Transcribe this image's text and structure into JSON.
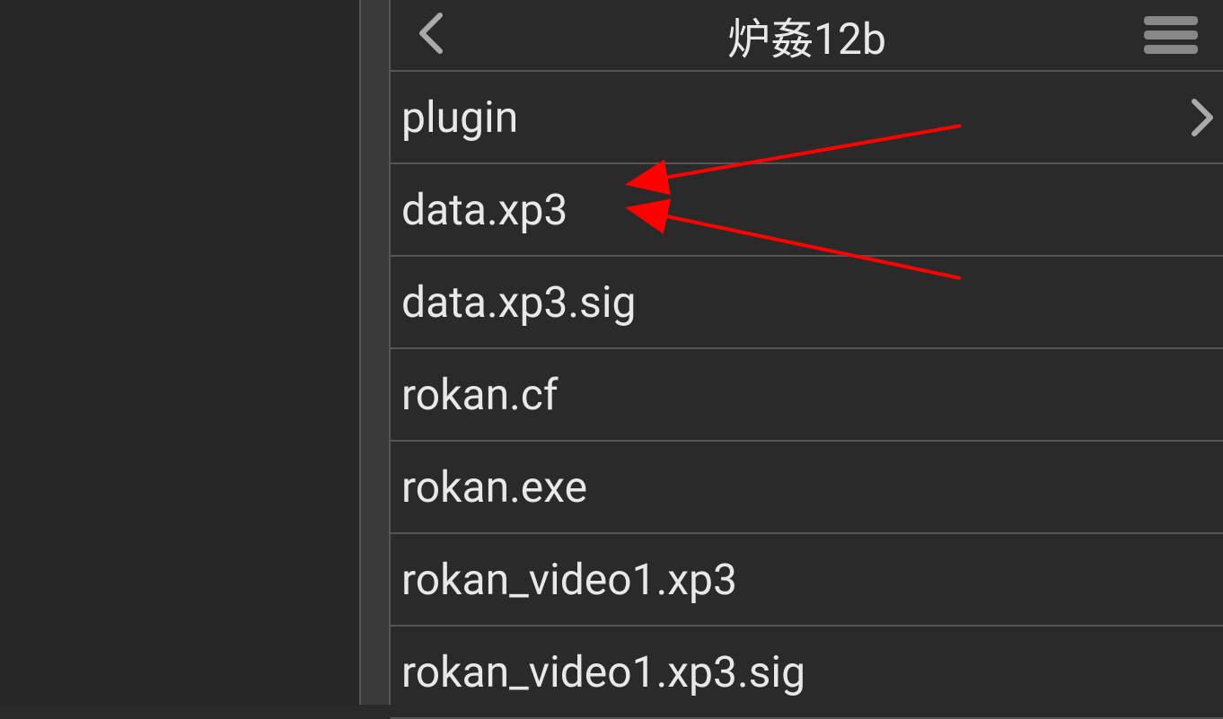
{
  "header": {
    "title": "炉姦12b"
  },
  "files": [
    {
      "name": "plugin",
      "type": "folder"
    },
    {
      "name": "data.xp3",
      "type": "file"
    },
    {
      "name": "data.xp3.sig",
      "type": "file"
    },
    {
      "name": "rokan.cf",
      "type": "file"
    },
    {
      "name": "rokan.exe",
      "type": "file"
    },
    {
      "name": "rokan_video1.xp3",
      "type": "file"
    },
    {
      "name": "rokan_video1.xp3.sig",
      "type": "file"
    }
  ],
  "annotation": {
    "target_file": "data.xp3",
    "arrow_color": "#ff0000"
  }
}
